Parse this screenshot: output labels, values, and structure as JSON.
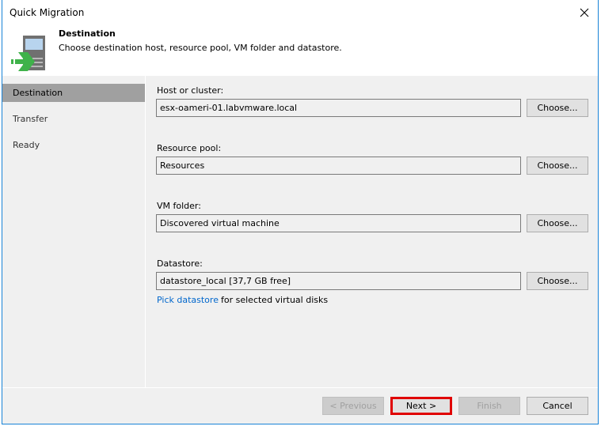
{
  "window": {
    "title": "Quick Migration",
    "close_icon": "close-icon"
  },
  "header": {
    "icon": "migration-server-arrow-icon",
    "title": "Destination",
    "description": "Choose destination host, resource pool, VM folder and datastore."
  },
  "sidebar": {
    "steps": [
      {
        "label": "Destination",
        "active": true
      },
      {
        "label": "Transfer",
        "active": false
      },
      {
        "label": "Ready",
        "active": false
      }
    ]
  },
  "form": {
    "host": {
      "label": "Host or cluster:",
      "value": "esx-oameri-01.labvmware.local",
      "button": "Choose..."
    },
    "pool": {
      "label": "Resource pool:",
      "value": "Resources",
      "button": "Choose..."
    },
    "folder": {
      "label": "VM folder:",
      "value": "Discovered virtual machine",
      "button": "Choose..."
    },
    "datastore": {
      "label": "Datastore:",
      "value": "datastore_local [37,7 GB free]",
      "button": "Choose..."
    },
    "pick_link": "Pick datastore",
    "pick_rest": "for selected virtual disks"
  },
  "footer": {
    "previous": "< Previous",
    "next": "Next >",
    "finish": "Finish",
    "cancel": "Cancel"
  },
  "colors": {
    "accent_border": "#1883d7",
    "link": "#0066cc",
    "highlight": "#e00000",
    "active_step": "#a0a0a0"
  }
}
